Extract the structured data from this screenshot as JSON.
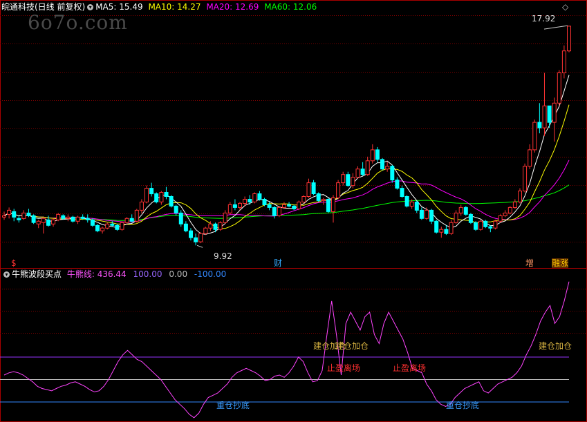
{
  "main_panel": {
    "title": "皖通科技(日线 前复权)",
    "indicators": [
      {
        "label": "MA5: 15.49",
        "color": "#ffffff"
      },
      {
        "label": "MA10: 14.27",
        "color": "#ffff00"
      },
      {
        "label": "MA20: 12.69",
        "color": "#ff00ff"
      },
      {
        "label": "MA60: 12.06",
        "color": "#00ff00"
      }
    ],
    "watermark": "6o7o.com",
    "high_label": "17.92",
    "low_label": "9.92",
    "markers": [
      {
        "text": "$",
        "color": "#ff3333"
      },
      {
        "text": "财",
        "color": "#33aaff"
      },
      {
        "text": "增",
        "color": "#ff9966"
      },
      {
        "text": "融涨",
        "color": "#ffcc00"
      }
    ]
  },
  "sub_panel": {
    "title": "牛熊波段买点",
    "indicators": [
      {
        "label": "牛熊线: 436.44",
        "color": "#ff55ff"
      },
      {
        "label": "100.00",
        "color": "#9966ff"
      },
      {
        "label": "0.00",
        "color": "#bbbbbb"
      },
      {
        "label": "-100.00",
        "color": "#3388ff"
      }
    ],
    "signals": [
      {
        "text": "建仓加仓",
        "color": "#d4b040"
      },
      {
        "text": "建仓加仓",
        "color": "#d4b040"
      },
      {
        "text": "止盈离场",
        "color": "#ff3030"
      },
      {
        "text": "止盈离场",
        "color": "#ff3030"
      },
      {
        "text": "重仓抄底",
        "color": "#3a9cff"
      },
      {
        "text": "重仓抄底",
        "color": "#3a9cff"
      },
      {
        "text": "建仓加仓",
        "color": "#d4b040"
      }
    ]
  },
  "chart_data": [
    {
      "type": "candlestick",
      "title": "皖通科技(日线 前复权)",
      "up_color": "#ff3333",
      "down_color": "#00ffff",
      "ylim": [
        9.5,
        18.3
      ],
      "candles": [
        [
          10.95,
          11.15,
          10.85,
          11.0
        ],
        [
          11.05,
          11.3,
          10.9,
          11.2
        ],
        [
          11.15,
          11.25,
          10.8,
          10.95
        ],
        [
          10.9,
          11.0,
          10.75,
          10.85
        ],
        [
          10.9,
          11.2,
          10.85,
          11.1
        ],
        [
          11.1,
          11.25,
          10.95,
          11.0
        ],
        [
          11.0,
          11.05,
          10.7,
          10.75
        ],
        [
          10.7,
          10.85,
          10.55,
          10.8
        ],
        [
          10.75,
          10.95,
          10.35,
          10.9
        ],
        [
          10.85,
          11.0,
          10.6,
          10.65
        ],
        [
          10.7,
          10.9,
          10.6,
          10.85
        ],
        [
          10.85,
          11.1,
          10.8,
          11.05
        ],
        [
          11.0,
          11.05,
          10.85,
          10.9
        ],
        [
          10.9,
          11.05,
          10.8,
          10.95
        ],
        [
          10.95,
          11.0,
          10.75,
          10.8
        ],
        [
          10.8,
          11.0,
          10.7,
          10.95
        ],
        [
          10.95,
          11.05,
          10.85,
          10.9
        ],
        [
          10.9,
          11.05,
          10.75,
          10.85
        ],
        [
          10.85,
          10.9,
          10.6,
          10.65
        ],
        [
          10.65,
          10.7,
          10.4,
          10.45
        ],
        [
          10.45,
          10.6,
          10.35,
          10.55
        ],
        [
          10.55,
          10.75,
          10.5,
          10.7
        ],
        [
          10.7,
          10.8,
          10.6,
          10.65
        ],
        [
          10.65,
          10.7,
          10.45,
          10.5
        ],
        [
          10.5,
          10.8,
          10.45,
          10.75
        ],
        [
          10.75,
          10.95,
          10.7,
          10.9
        ],
        [
          10.9,
          11.05,
          10.75,
          10.8
        ],
        [
          10.8,
          11.25,
          10.75,
          11.2
        ],
        [
          11.2,
          11.6,
          11.1,
          11.5
        ],
        [
          11.5,
          12.1,
          11.45,
          12.0
        ],
        [
          12.0,
          12.2,
          11.7,
          11.8
        ],
        [
          11.8,
          11.85,
          11.45,
          11.5
        ],
        [
          11.5,
          11.9,
          11.4,
          11.85
        ],
        [
          11.85,
          12.05,
          11.6,
          11.7
        ],
        [
          11.7,
          11.75,
          11.3,
          11.35
        ],
        [
          11.35,
          11.4,
          11.0,
          11.1
        ],
        [
          11.1,
          11.2,
          10.6,
          10.7
        ],
        [
          10.7,
          10.8,
          10.4,
          10.45
        ],
        [
          10.45,
          10.55,
          10.1,
          10.2
        ],
        [
          10.2,
          10.35,
          9.92,
          10.05
        ],
        [
          10.05,
          10.4,
          10.0,
          10.35
        ],
        [
          10.35,
          10.6,
          10.3,
          10.55
        ],
        [
          10.55,
          10.8,
          10.45,
          10.7
        ],
        [
          10.7,
          10.75,
          10.4,
          10.5
        ],
        [
          10.5,
          10.8,
          10.45,
          10.75
        ],
        [
          10.75,
          11.2,
          10.7,
          11.1
        ],
        [
          11.1,
          11.5,
          11.05,
          11.4
        ],
        [
          11.4,
          11.6,
          11.2,
          11.3
        ],
        [
          11.3,
          11.5,
          11.2,
          11.45
        ],
        [
          11.45,
          11.7,
          11.35,
          11.6
        ],
        [
          11.6,
          11.75,
          11.4,
          11.5
        ],
        [
          11.5,
          11.85,
          11.45,
          11.8
        ],
        [
          11.8,
          11.9,
          11.55,
          11.6
        ],
        [
          11.6,
          11.65,
          11.35,
          11.4
        ],
        [
          11.4,
          11.5,
          11.2,
          11.3
        ],
        [
          11.3,
          11.35,
          10.9,
          11.0
        ],
        [
          11.0,
          11.35,
          10.95,
          11.3
        ],
        [
          11.3,
          11.5,
          11.25,
          11.4
        ],
        [
          11.4,
          11.5,
          11.3,
          11.35
        ],
        [
          11.35,
          11.4,
          11.2,
          11.25
        ],
        [
          11.25,
          11.55,
          11.2,
          11.5
        ],
        [
          11.5,
          11.75,
          11.45,
          11.7
        ],
        [
          11.7,
          12.35,
          11.65,
          12.2
        ],
        [
          12.2,
          12.3,
          11.75,
          11.8
        ],
        [
          11.8,
          11.85,
          11.5,
          11.55
        ],
        [
          11.55,
          11.65,
          11.4,
          11.6
        ],
        [
          11.6,
          11.65,
          11.1,
          11.15
        ],
        [
          11.15,
          11.75,
          10.75,
          11.65
        ],
        [
          11.65,
          12.3,
          11.6,
          12.2
        ],
        [
          12.2,
          12.6,
          12.1,
          12.5
        ],
        [
          12.5,
          12.6,
          12.05,
          12.1
        ],
        [
          12.1,
          12.55,
          12.0,
          12.4
        ],
        [
          12.4,
          12.8,
          12.35,
          12.7
        ],
        [
          12.7,
          12.95,
          12.45,
          12.5
        ],
        [
          12.5,
          13.15,
          12.45,
          13.0
        ],
        [
          13.0,
          13.6,
          12.9,
          13.4
        ],
        [
          13.4,
          13.5,
          12.95,
          13.05
        ],
        [
          13.05,
          13.1,
          12.65,
          12.7
        ],
        [
          12.7,
          12.95,
          12.6,
          12.8
        ],
        [
          12.8,
          12.85,
          12.2,
          12.3
        ],
        [
          12.3,
          12.4,
          11.95,
          12.0
        ],
        [
          12.0,
          12.1,
          11.65,
          11.7
        ],
        [
          11.7,
          11.75,
          11.3,
          11.35
        ],
        [
          11.35,
          11.6,
          11.25,
          11.5
        ],
        [
          11.5,
          11.55,
          11.1,
          11.2
        ],
        [
          11.2,
          11.3,
          10.85,
          10.9
        ],
        [
          10.9,
          11.3,
          10.85,
          11.2
        ],
        [
          11.2,
          11.25,
          10.7,
          10.8
        ],
        [
          10.8,
          10.85,
          10.35,
          10.4
        ],
        [
          10.4,
          10.6,
          10.2,
          10.5
        ],
        [
          10.5,
          10.65,
          10.3,
          10.35
        ],
        [
          10.35,
          10.85,
          10.3,
          10.75
        ],
        [
          10.75,
          11.2,
          10.7,
          11.1
        ],
        [
          11.1,
          11.4,
          11.0,
          11.3
        ],
        [
          11.3,
          11.35,
          11.0,
          11.05
        ],
        [
          11.05,
          11.1,
          10.7,
          10.75
        ],
        [
          10.75,
          10.8,
          10.45,
          10.5
        ],
        [
          10.5,
          10.85,
          10.45,
          10.8
        ],
        [
          10.8,
          10.85,
          10.55,
          10.6
        ],
        [
          10.6,
          10.65,
          10.4,
          10.55
        ],
        [
          10.55,
          10.85,
          10.5,
          10.8
        ],
        [
          10.8,
          11.05,
          10.75,
          11.0
        ],
        [
          11.0,
          11.2,
          10.95,
          11.1
        ],
        [
          11.1,
          11.35,
          11.05,
          11.3
        ],
        [
          11.3,
          11.6,
          11.25,
          11.5
        ],
        [
          11.5,
          12.0,
          11.45,
          11.9
        ],
        [
          11.9,
          12.9,
          11.85,
          12.8
        ],
        [
          12.8,
          13.6,
          12.7,
          13.4
        ],
        [
          13.4,
          14.5,
          13.3,
          14.4
        ],
        [
          14.4,
          15.1,
          14.0,
          14.2
        ],
        [
          14.2,
          16.2,
          13.9,
          15.0
        ],
        [
          15.0,
          15.0,
          14.2,
          14.4
        ],
        [
          14.4,
          15.3,
          13.7,
          15.1
        ],
        [
          15.1,
          16.3,
          15.0,
          16.2
        ],
        [
          16.2,
          17.2,
          16.0,
          17.0
        ],
        [
          17.0,
          17.92,
          16.95,
          17.9
        ]
      ]
    },
    {
      "type": "line",
      "title": "牛熊波段买点",
      "series": [
        {
          "name": "牛熊线",
          "color": "#ff44ff"
        }
      ],
      "reference_lines": [
        {
          "value": 100,
          "color": "#9933ff"
        },
        {
          "value": 0,
          "color": "#bbbbbb"
        },
        {
          "value": -100,
          "color": "#3388ff"
        }
      ],
      "ylim": [
        -180,
        460
      ],
      "values": [
        20,
        30,
        35,
        30,
        20,
        5,
        -10,
        -30,
        -40,
        -45,
        -50,
        -40,
        -30,
        -25,
        -15,
        -10,
        -20,
        -30,
        -45,
        -55,
        -50,
        -30,
        0,
        40,
        80,
        110,
        130,
        110,
        90,
        80,
        60,
        40,
        20,
        0,
        -30,
        -60,
        -90,
        -110,
        -130,
        -155,
        -170,
        -150,
        -110,
        -80,
        -70,
        -60,
        -40,
        -20,
        10,
        30,
        40,
        50,
        40,
        30,
        15,
        -5,
        0,
        15,
        20,
        10,
        30,
        60,
        100,
        80,
        30,
        -10,
        -5,
        40,
        200,
        350,
        200,
        20,
        250,
        300,
        260,
        220,
        280,
        300,
        200,
        160,
        250,
        300,
        260,
        220,
        180,
        120,
        50,
        40,
        30,
        -20,
        -50,
        -90,
        -110,
        -120,
        -110,
        -80,
        -60,
        -40,
        -30,
        -20,
        -10,
        -50,
        -60,
        -40,
        -20,
        -10,
        0,
        10,
        30,
        60,
        110,
        150,
        200,
        260,
        300,
        330,
        250,
        280,
        350,
        436
      ]
    }
  ]
}
